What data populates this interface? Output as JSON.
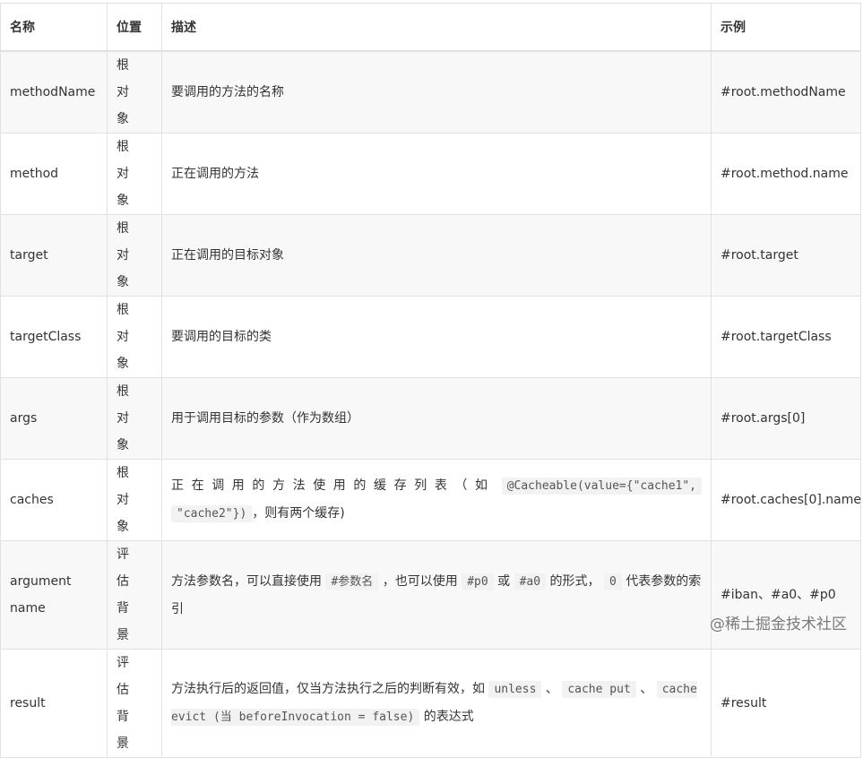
{
  "headers": {
    "name": "名称",
    "position": "位置",
    "description": "描述",
    "example": "示例"
  },
  "rows": [
    {
      "name": "methodName",
      "position": "根对象",
      "description": "要调用的方法的名称",
      "example": "#root.methodName"
    },
    {
      "name": "method",
      "position": "根对象",
      "description": "正在调用的方法",
      "example": "#root.method.name"
    },
    {
      "name": "target",
      "position": "根对象",
      "description": "正在调用的目标对象",
      "example": "#root.target"
    },
    {
      "name": "targetClass",
      "position": "根对象",
      "description": "要调用的目标的类",
      "example": "#root.targetClass"
    },
    {
      "name": "args",
      "position": "根对象",
      "description": "用于调用目标的参数（作为数组）",
      "example": "#root.args[0]"
    },
    {
      "name": "caches",
      "position": "根对象",
      "description": {
        "t1": "正在调用的方法使用的缓存列表（如",
        "c1": "@Cacheable(value={\"cache1\",",
        "c2": "\"cache2\"})",
        "t2": "，则有两个缓存)"
      },
      "example": "#root.caches[0].name"
    },
    {
      "name": "argument name",
      "position": "评估背景",
      "description": {
        "t1": "方法参数名，可以直接使用",
        "c1": "#参数名",
        "t2": "，也可以使用",
        "c2": "#p0",
        "t3": "或",
        "c3": "#a0",
        "t4": "的形式，",
        "c4": "0",
        "t5": "代表参数的索引"
      },
      "example": "#iban、#a0、#p0"
    },
    {
      "name": "result",
      "position": "评估背景",
      "description": {
        "t1": "方法执行后的返回值，仅当方法执行之后的判断有效，如",
        "c1": "unless",
        "t2": "、",
        "c2": "cache put",
        "t3": "、",
        "c3": "cache evict (当 beforeInvocation = false)",
        "t4": "的表达式"
      },
      "example": "#result"
    }
  ],
  "watermark": "@稀土掘金技术社区"
}
